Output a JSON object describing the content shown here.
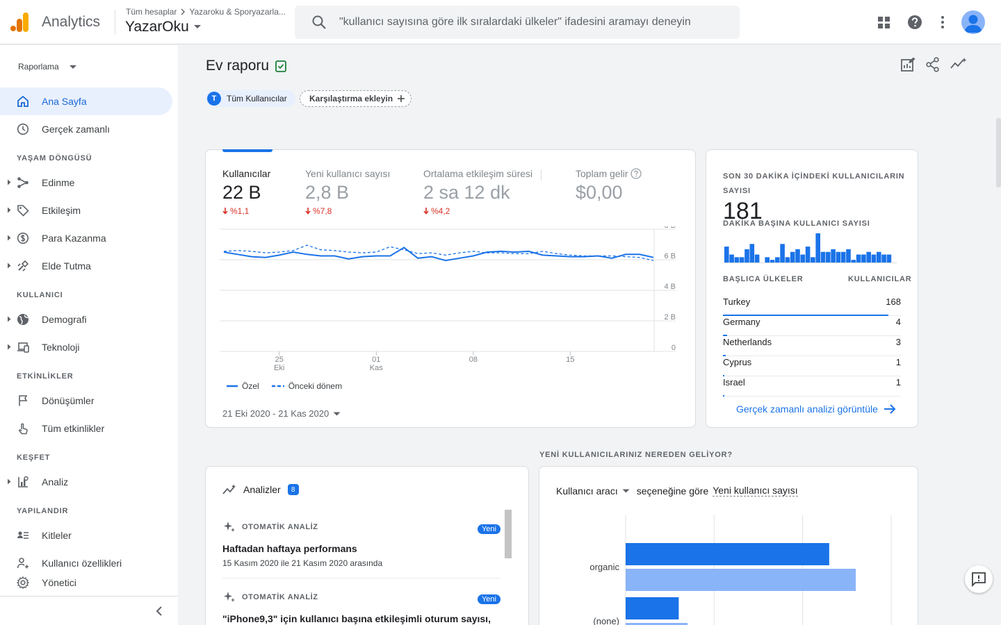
{
  "header": {
    "app_name": "Analytics",
    "breadcrumb": [
      "Tüm hesaplar",
      "Yazaroku & Sporyazarla..."
    ],
    "property_name": "YazarOku",
    "search_placeholder": "\"kullanıcı sayısına göre ilk sıralardaki ülkeler\" ifadesini aramayı deneyin",
    "icons": [
      "apps-grid-icon",
      "help-icon",
      "more-vert-icon",
      "account-avatar"
    ]
  },
  "sidebar": {
    "dropdown_label": "Raporlama",
    "top_items": [
      {
        "label": "Ana Sayfa",
        "icon": "home-icon",
        "active": true
      },
      {
        "label": "Gerçek zamanlı",
        "icon": "clock-icon"
      }
    ],
    "sections": [
      {
        "title": "YAŞAM DÖNGÜSÜ",
        "items": [
          {
            "label": "Edinme",
            "icon": "acquisition-icon"
          },
          {
            "label": "Etkileşim",
            "icon": "tag-icon"
          },
          {
            "label": "Para Kazanma",
            "icon": "dollar-icon"
          },
          {
            "label": "Elde Tutma",
            "icon": "retention-icon"
          }
        ]
      },
      {
        "title": "KULLANICI",
        "items": [
          {
            "label": "Demografi",
            "icon": "globe-icon"
          },
          {
            "label": "Teknoloji",
            "icon": "devices-icon"
          }
        ]
      },
      {
        "title": "ETKİNLİKLER",
        "items": [
          {
            "label": "Dönüşümler",
            "icon": "flag-icon"
          },
          {
            "label": "Tüm etkinlikler",
            "icon": "touch-icon"
          }
        ]
      },
      {
        "title": "KEŞFET",
        "items": [
          {
            "label": "Analiz",
            "icon": "analysis-icon"
          }
        ]
      },
      {
        "title": "YAPILANDIR",
        "items": [
          {
            "label": "Kitleler",
            "icon": "audience-icon"
          },
          {
            "label": "Kullanıcı özellikleri",
            "icon": "user-props-icon"
          }
        ]
      }
    ],
    "footer_item": {
      "label": "Yönetici",
      "icon": "gear-icon"
    }
  },
  "main": {
    "title": "Ev raporu",
    "comparison_chip": {
      "letter": "T",
      "label": "Tüm Kullanıcılar"
    },
    "add_comparison_label": "Karşılaştırma ekleyin",
    "metrics": [
      {
        "label": "Kullanıcılar",
        "value": "22 B",
        "change": "%1,1"
      },
      {
        "label": "Yeni kullanıcı sayısı",
        "value": "2,8 B",
        "change": "%7,8"
      },
      {
        "label": "Ortalama etkileşim süresi",
        "value": "2 sa 12 dk",
        "change": "%4,2"
      },
      {
        "label": "Toplam gelir",
        "value": "$0,00",
        "change": ""
      }
    ],
    "legend": {
      "current": "Özel",
      "previous": "Önceki dönem"
    },
    "date_range": "21 Eki 2020 - 21 Kas 2020",
    "realtime": {
      "title": "SON 30 DAKİKA İÇİNDEKİ KULLANICILARIN SAYISI",
      "value": "181",
      "per_minute_label": "DAKİKA BAŞINA KULLANICI SAYISI",
      "col_country": "BAŞLICA ÜLKELER",
      "col_users": "KULLANICILAR",
      "countries": [
        {
          "name": "Turkey",
          "count": "168",
          "share": 1.0
        },
        {
          "name": "Germany",
          "count": "4",
          "share": 0.024
        },
        {
          "name": "Netherlands",
          "count": "3",
          "share": 0.018
        },
        {
          "name": "Cyprus",
          "count": "1",
          "share": 0.006
        },
        {
          "name": "Israel",
          "count": "1",
          "share": 0.006
        }
      ],
      "per_minute_values": [
        6,
        3,
        2,
        2,
        5,
        7,
        3,
        0,
        2,
        1,
        2,
        7,
        2,
        4,
        5,
        3,
        6,
        2,
        11,
        4,
        4,
        5,
        4,
        4,
        5,
        1,
        3,
        3,
        4,
        3,
        4,
        3,
        3,
        0
      ],
      "link": "Gerçek zamanlı analizi görüntüle"
    },
    "insights": {
      "title": "Analizler",
      "count": "8",
      "items": [
        {
          "kind": "OTOMATİK ANALİZ",
          "badge": "Yeni",
          "title": "Haftadan haftaya performans",
          "subtitle": "15 Kasım 2020 ile 21 Kasım 2020 arasında"
        },
        {
          "kind": "OTOMATİK ANALİZ",
          "badge": "Yeni",
          "title": "\"iPhone9,3\" için kullanıcı başına etkileşimli oturum sayısı,",
          "subtitle": ""
        }
      ]
    },
    "source_section_title": "YENİ KULLANICILARINIZ NEREDEN GELİYOR?",
    "source_card": {
      "dimension": "Kullanıcı aracı",
      "connector": "seçeneğine göre",
      "metric": "Yeni kullanıcı sayısı"
    }
  },
  "colors": {
    "accent": "#1a73e8",
    "accent_light": "#8ab4f8",
    "negative": "#d93025"
  },
  "chart_data": [
    {
      "type": "line",
      "x_tick_labels": [
        [
          "25",
          "Eki"
        ],
        [
          "01",
          "Kas"
        ],
        [
          "08",
          ""
        ],
        [
          "15",
          ""
        ]
      ],
      "y_tick_labels": [
        "8 B",
        "6 B",
        "4 B",
        "2 B",
        "0"
      ],
      "ylim": [
        0,
        8000
      ],
      "x": [
        "21 Eki",
        "22 Eki",
        "23 Eki",
        "24 Eki",
        "25 Eki",
        "26 Eki",
        "27 Eki",
        "28 Eki",
        "29 Eki",
        "30 Eki",
        "31 Eki",
        "01 Kas",
        "02 Kas",
        "03 Kas",
        "04 Kas",
        "05 Kas",
        "06 Kas",
        "07 Kas",
        "08 Kas",
        "09 Kas",
        "10 Kas",
        "11 Kas",
        "12 Kas",
        "13 Kas",
        "14 Kas",
        "15 Kas",
        "16 Kas",
        "17 Kas",
        "18 Kas",
        "19 Kas",
        "20 Kas",
        "21 Kas"
      ],
      "series": [
        {
          "name": "Özel",
          "style": "solid",
          "values": [
            6500,
            6350,
            6200,
            6150,
            6300,
            6500,
            6350,
            6250,
            6250,
            6050,
            6200,
            6250,
            6250,
            6800,
            6100,
            6200,
            5950,
            6100,
            6250,
            6500,
            6550,
            6500,
            6550,
            6300,
            6250,
            6200,
            6200,
            6250,
            6100,
            6350,
            6350,
            6150
          ]
        },
        {
          "name": "Önceki dönem",
          "style": "dashed",
          "values": [
            6550,
            6600,
            6550,
            6450,
            6500,
            6600,
            6950,
            6650,
            6600,
            6500,
            6450,
            6500,
            6850,
            6650,
            6400,
            6450,
            6300,
            6450,
            6550,
            6450,
            6450,
            6400,
            6400,
            6550,
            6400,
            6300,
            6250,
            6250,
            6250,
            6200,
            6150,
            5950
          ]
        }
      ]
    },
    {
      "type": "bar",
      "orientation": "horizontal",
      "categories": [
        "organic",
        "(none)"
      ],
      "series": [
        {
          "values": [
            1150,
            300
          ]
        },
        {
          "values": [
            1300,
            350
          ]
        }
      ],
      "xlim": [
        0,
        1500
      ]
    }
  ]
}
